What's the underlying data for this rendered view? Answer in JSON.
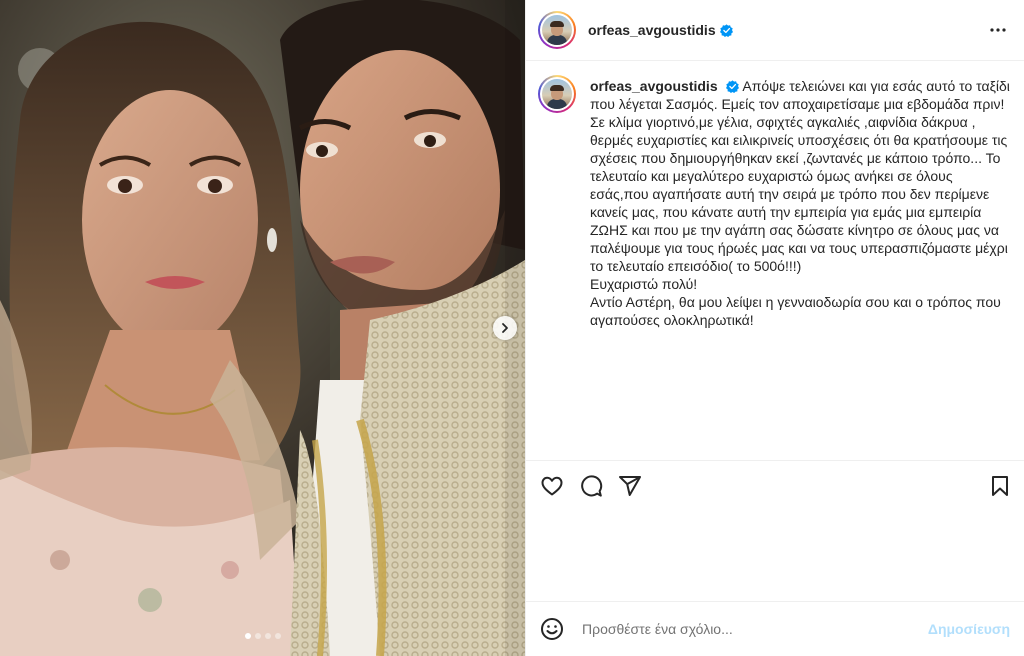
{
  "header": {
    "username": "orfeas_avgoustidis",
    "more_icon": "more-horizontal-icon"
  },
  "caption": {
    "username": "orfeas_avgoustidis",
    "text": "Απόψε τελειώνει και για εσάς αυτό το ταξίδι που λέγεται Σασμός. Εμείς τον αποχαιρετίσαμε μια εβδομάδα πριν!Σε κλίμα γιορτινό,με γέλια, σφιχτές αγκαλιές ,αιφνίδια δάκρυα , θερμές ευχαριστίες και ειλικρινείς υποσχέσεις ότι θα κρατήσουμε τις σχέσεις που δημιουργήθηκαν εκεί ,ζωντανές με κάποιο τρόπο... Το τελευταίο και μεγαλύτερο ευχαριστώ όμως ανήκει σε όλους εσάς,που αγαπήσατε αυτή την σειρά με τρόπο που δεν περίμενε κανείς μας, που κάνατε αυτή την εμπειρία για εμάς μια εμπειρία ΖΩΗΣ και που με την αγάπη σας δώσατε κίνητρο σε όλους μας να παλέψουμε για τους ήρωές μας και να τους υπερασπιζόμαστε μέχρι το τελευταίο επεισόδιο( το 500ό!!!)\nΕυχαριστώ πολύ!\nΑντίο Αστέρη, θα μου λείψει η γενναιοδωρία σου και ο τρόπος που αγαπούσες ολοκληρωτικά!"
  },
  "actions": {
    "like_icon": "heart-icon",
    "comment_icon": "comment-icon",
    "share_icon": "share-icon",
    "save_icon": "bookmark-icon"
  },
  "comment_box": {
    "placeholder": "Προσθέστε ένα σχόλιο...",
    "post_label": "Δημοσίευση"
  },
  "carousel": {
    "count": 4,
    "active_index": 0
  },
  "colors": {
    "verified": "#0095f6",
    "post_disabled": "#b2dffc",
    "border": "#efefef"
  }
}
